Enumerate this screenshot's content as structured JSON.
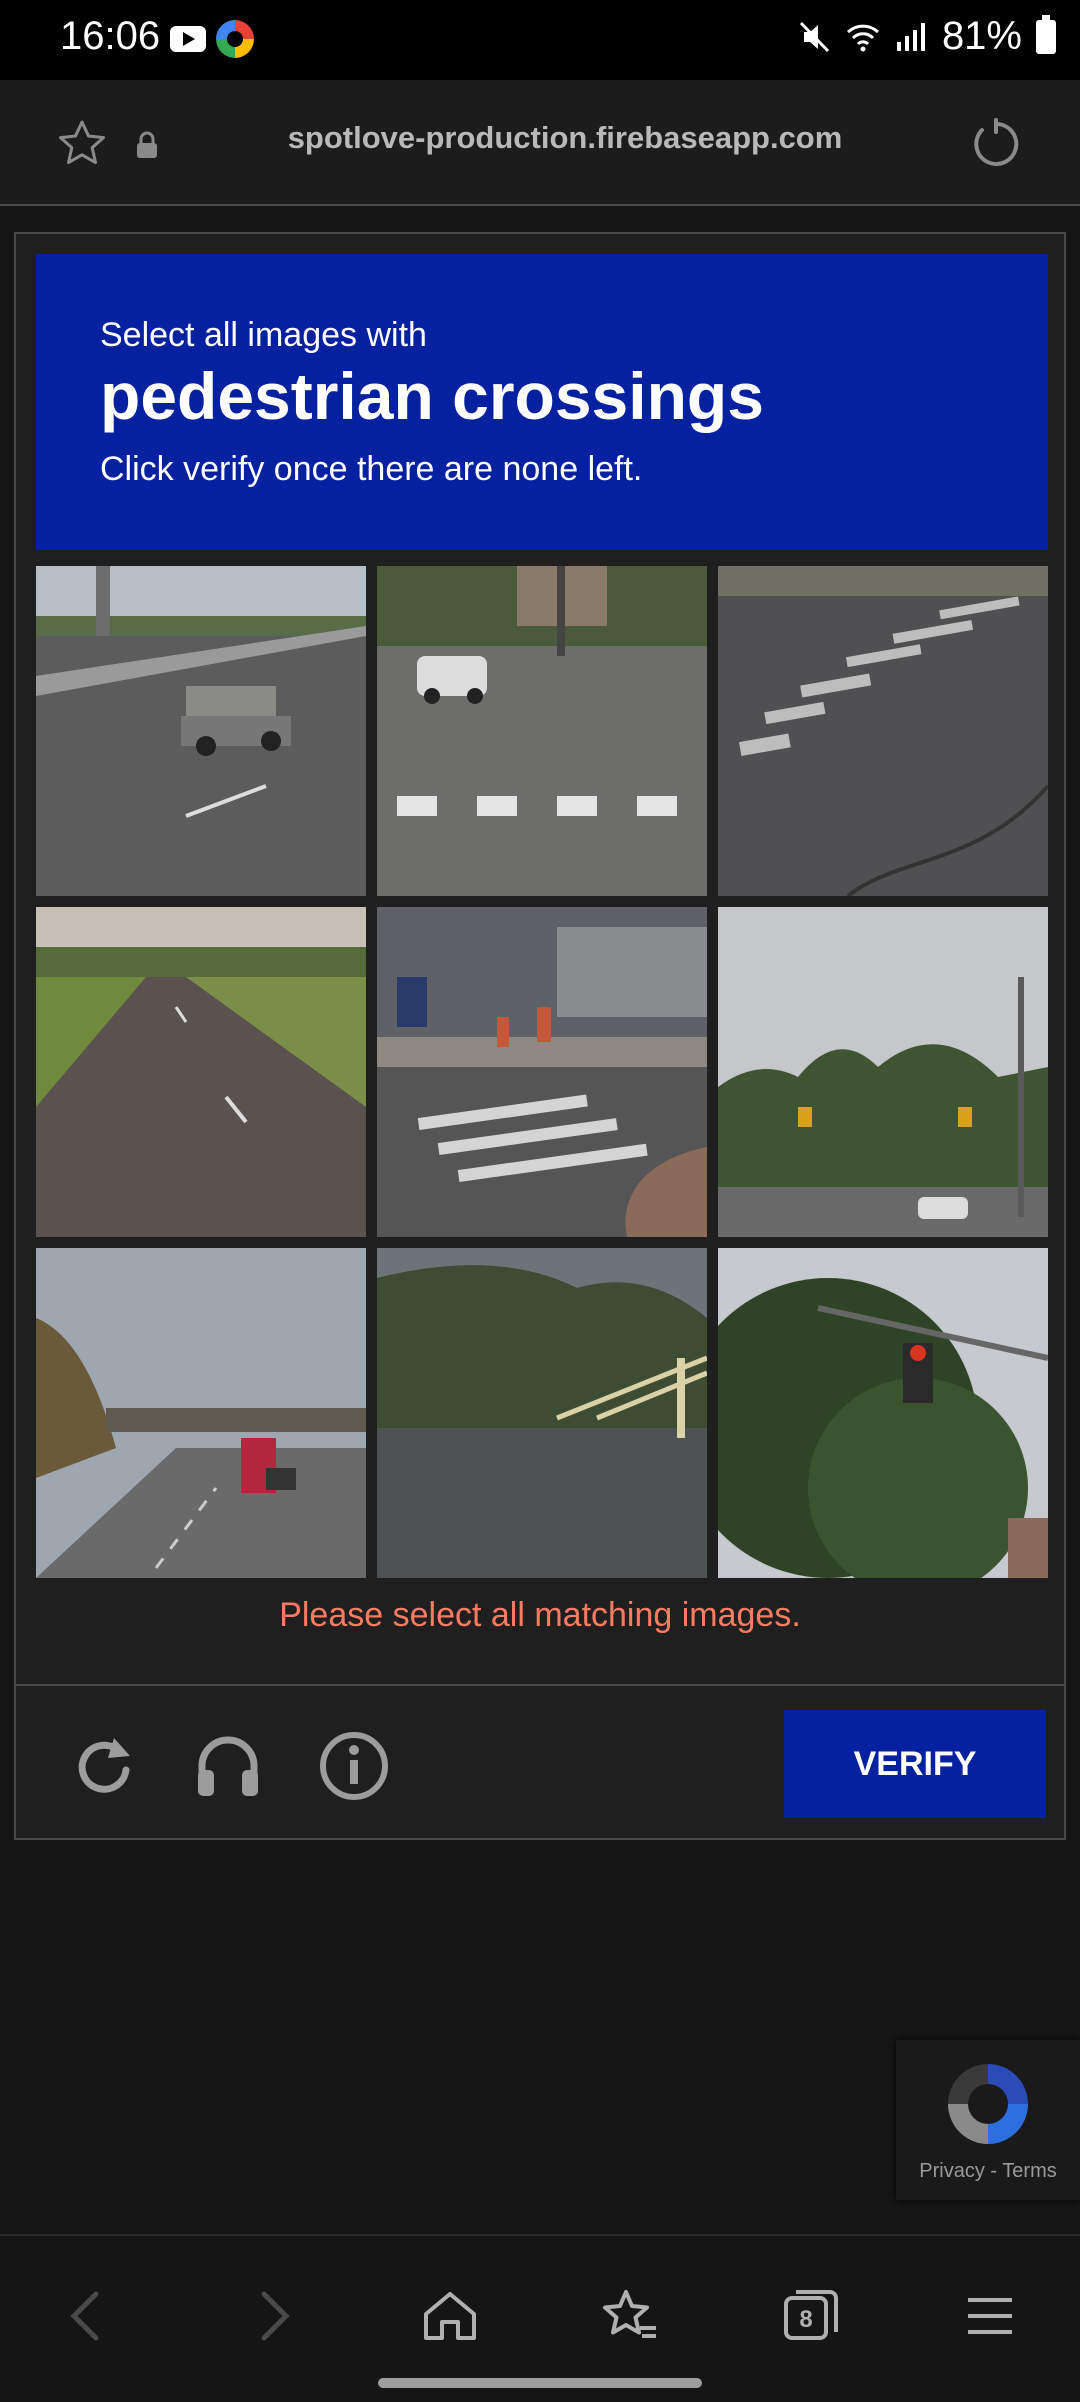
{
  "status_bar": {
    "time": "16:06",
    "battery": "81%",
    "icons": [
      "youtube-icon",
      "app-icon",
      "mute-icon",
      "wifi-icon",
      "signal-icon",
      "battery-icon"
    ]
  },
  "browser": {
    "url": "spotlove-production.firebaseapp.com",
    "icons": [
      "star-icon",
      "lock-icon",
      "reload-icon"
    ]
  },
  "captcha": {
    "instruction_line1": "Select all images with",
    "target": "pedestrian crossings",
    "instruction_line3": "Click verify once there are none left.",
    "error_message": "Please select all matching images.",
    "verify_label": "VERIFY",
    "footer_icons": [
      "refresh-icon",
      "audio-challenge-icon",
      "info-icon"
    ],
    "tiles": [
      {
        "id": 1,
        "scene": "highway with pickup truck"
      },
      {
        "id": 2,
        "scene": "street with white car and crosswalk"
      },
      {
        "id": 3,
        "scene": "asphalt with crosswalk stripes"
      },
      {
        "id": 4,
        "scene": "empty rural road"
      },
      {
        "id": 5,
        "scene": "sidewalk with hydrants and crosswalk"
      },
      {
        "id": 6,
        "scene": "street with traffic lights and trees"
      },
      {
        "id": 7,
        "scene": "highway under overpass with truck"
      },
      {
        "id": 8,
        "scene": "river with bridge and hills"
      },
      {
        "id": 9,
        "scene": "tree with traffic light"
      }
    ],
    "accent_color": "#0621a0",
    "error_color": "#ff7b62"
  },
  "recaptcha_badge": {
    "privacy": "Privacy",
    "separator": "-",
    "terms": "Terms"
  },
  "nav": {
    "tab_count": "8",
    "icons": [
      "back-icon",
      "forward-icon",
      "home-icon",
      "bookmarks-icon",
      "tabs-icon",
      "menu-icon"
    ]
  }
}
